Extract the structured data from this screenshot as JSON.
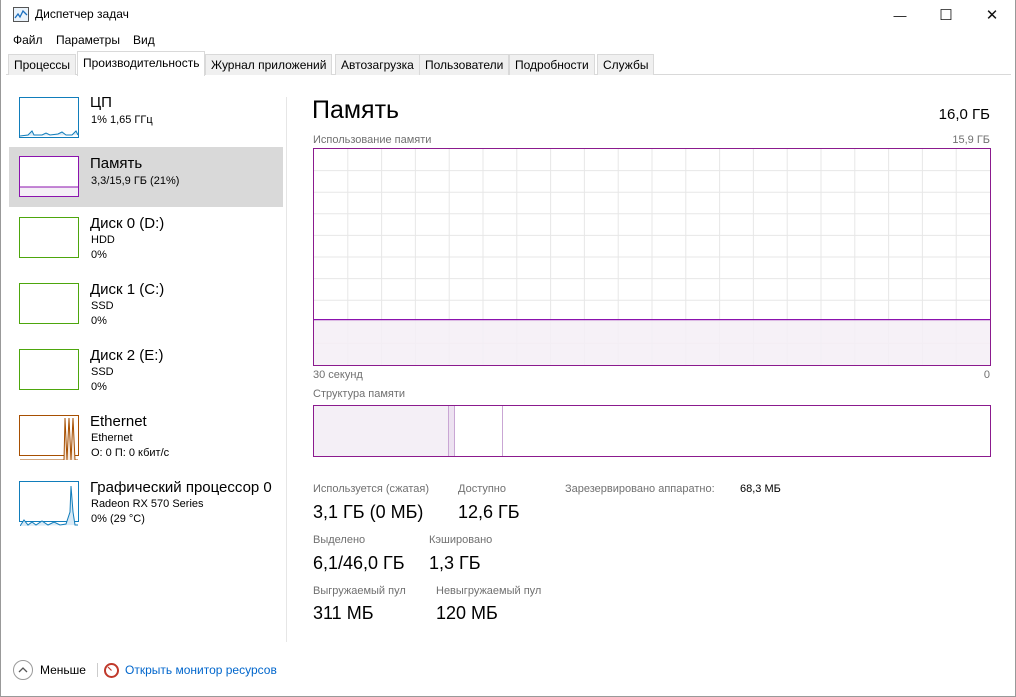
{
  "window": {
    "title": "Диспетчер задач",
    "minimize_glyph": "—",
    "maximize_glyph": "☐",
    "close_glyph": "✕"
  },
  "menu": [
    "Файл",
    "Параметры",
    "Вид"
  ],
  "tabs": [
    "Процессы",
    "Производительность",
    "Журнал приложений",
    "Автозагрузка",
    "Пользователи",
    "Подробности",
    "Службы"
  ],
  "active_tab": "Производительность",
  "sidebar": [
    {
      "name": "ЦП",
      "line1": "1% 1,65 ГГц",
      "line2": "",
      "color": "#117dbb"
    },
    {
      "name": "Память",
      "line1": "3,3/15,9 ГБ (21%)",
      "line2": "",
      "color": "#8b12ae",
      "selected": true
    },
    {
      "name": "Диск 0 (D:)",
      "line1": "HDD",
      "line2": "0%",
      "color": "#4da60c"
    },
    {
      "name": "Диск 1 (C:)",
      "line1": "SSD",
      "line2": "0%",
      "color": "#4da60c"
    },
    {
      "name": "Диск 2 (E:)",
      "line1": "SSD",
      "line2": "0%",
      "color": "#4da60c"
    },
    {
      "name": "Ethernet",
      "line1": "Ethernet",
      "line2": "О: 0 П: 0 кбит/с",
      "color": "#a74f01"
    },
    {
      "name": "Графический процессор 0",
      "line1": "Radeon RX 570 Series",
      "line2": "0% (29 °C)",
      "color": "#117dbb"
    }
  ],
  "main": {
    "title": "Память",
    "total": "16,0 ГБ",
    "usage_label": "Использование памяти",
    "usage_max": "15,9 ГБ",
    "time_label": "30 секунд",
    "time_end": "0",
    "structure_label": "Структура памяти",
    "usage_fraction": 0.21,
    "stats": {
      "in_use_label": "Используется (сжатая)",
      "in_use_value": "3,1 ГБ (0 МБ)",
      "available_label": "Доступно",
      "available_value": "12,6 ГБ",
      "reserved_label": "Зарезервировано аппаратно:",
      "reserved_value": "68,3 МБ",
      "committed_label": "Выделено",
      "committed_value": "6,1/46,0 ГБ",
      "cached_label": "Кэшировано",
      "cached_value": "1,3 ГБ",
      "paged_label": "Выгружаемый пул",
      "paged_value": "311 МБ",
      "nonpaged_label": "Невыгружаемый пул",
      "nonpaged_value": "120 МБ"
    }
  },
  "footer": {
    "less_label": "Меньше",
    "monitor_link": "Открыть монитор ресурсов"
  },
  "colors": {
    "memory": "#8b12ae",
    "memory_fill": "#f4eff6",
    "grid": "#e7e7e7"
  }
}
